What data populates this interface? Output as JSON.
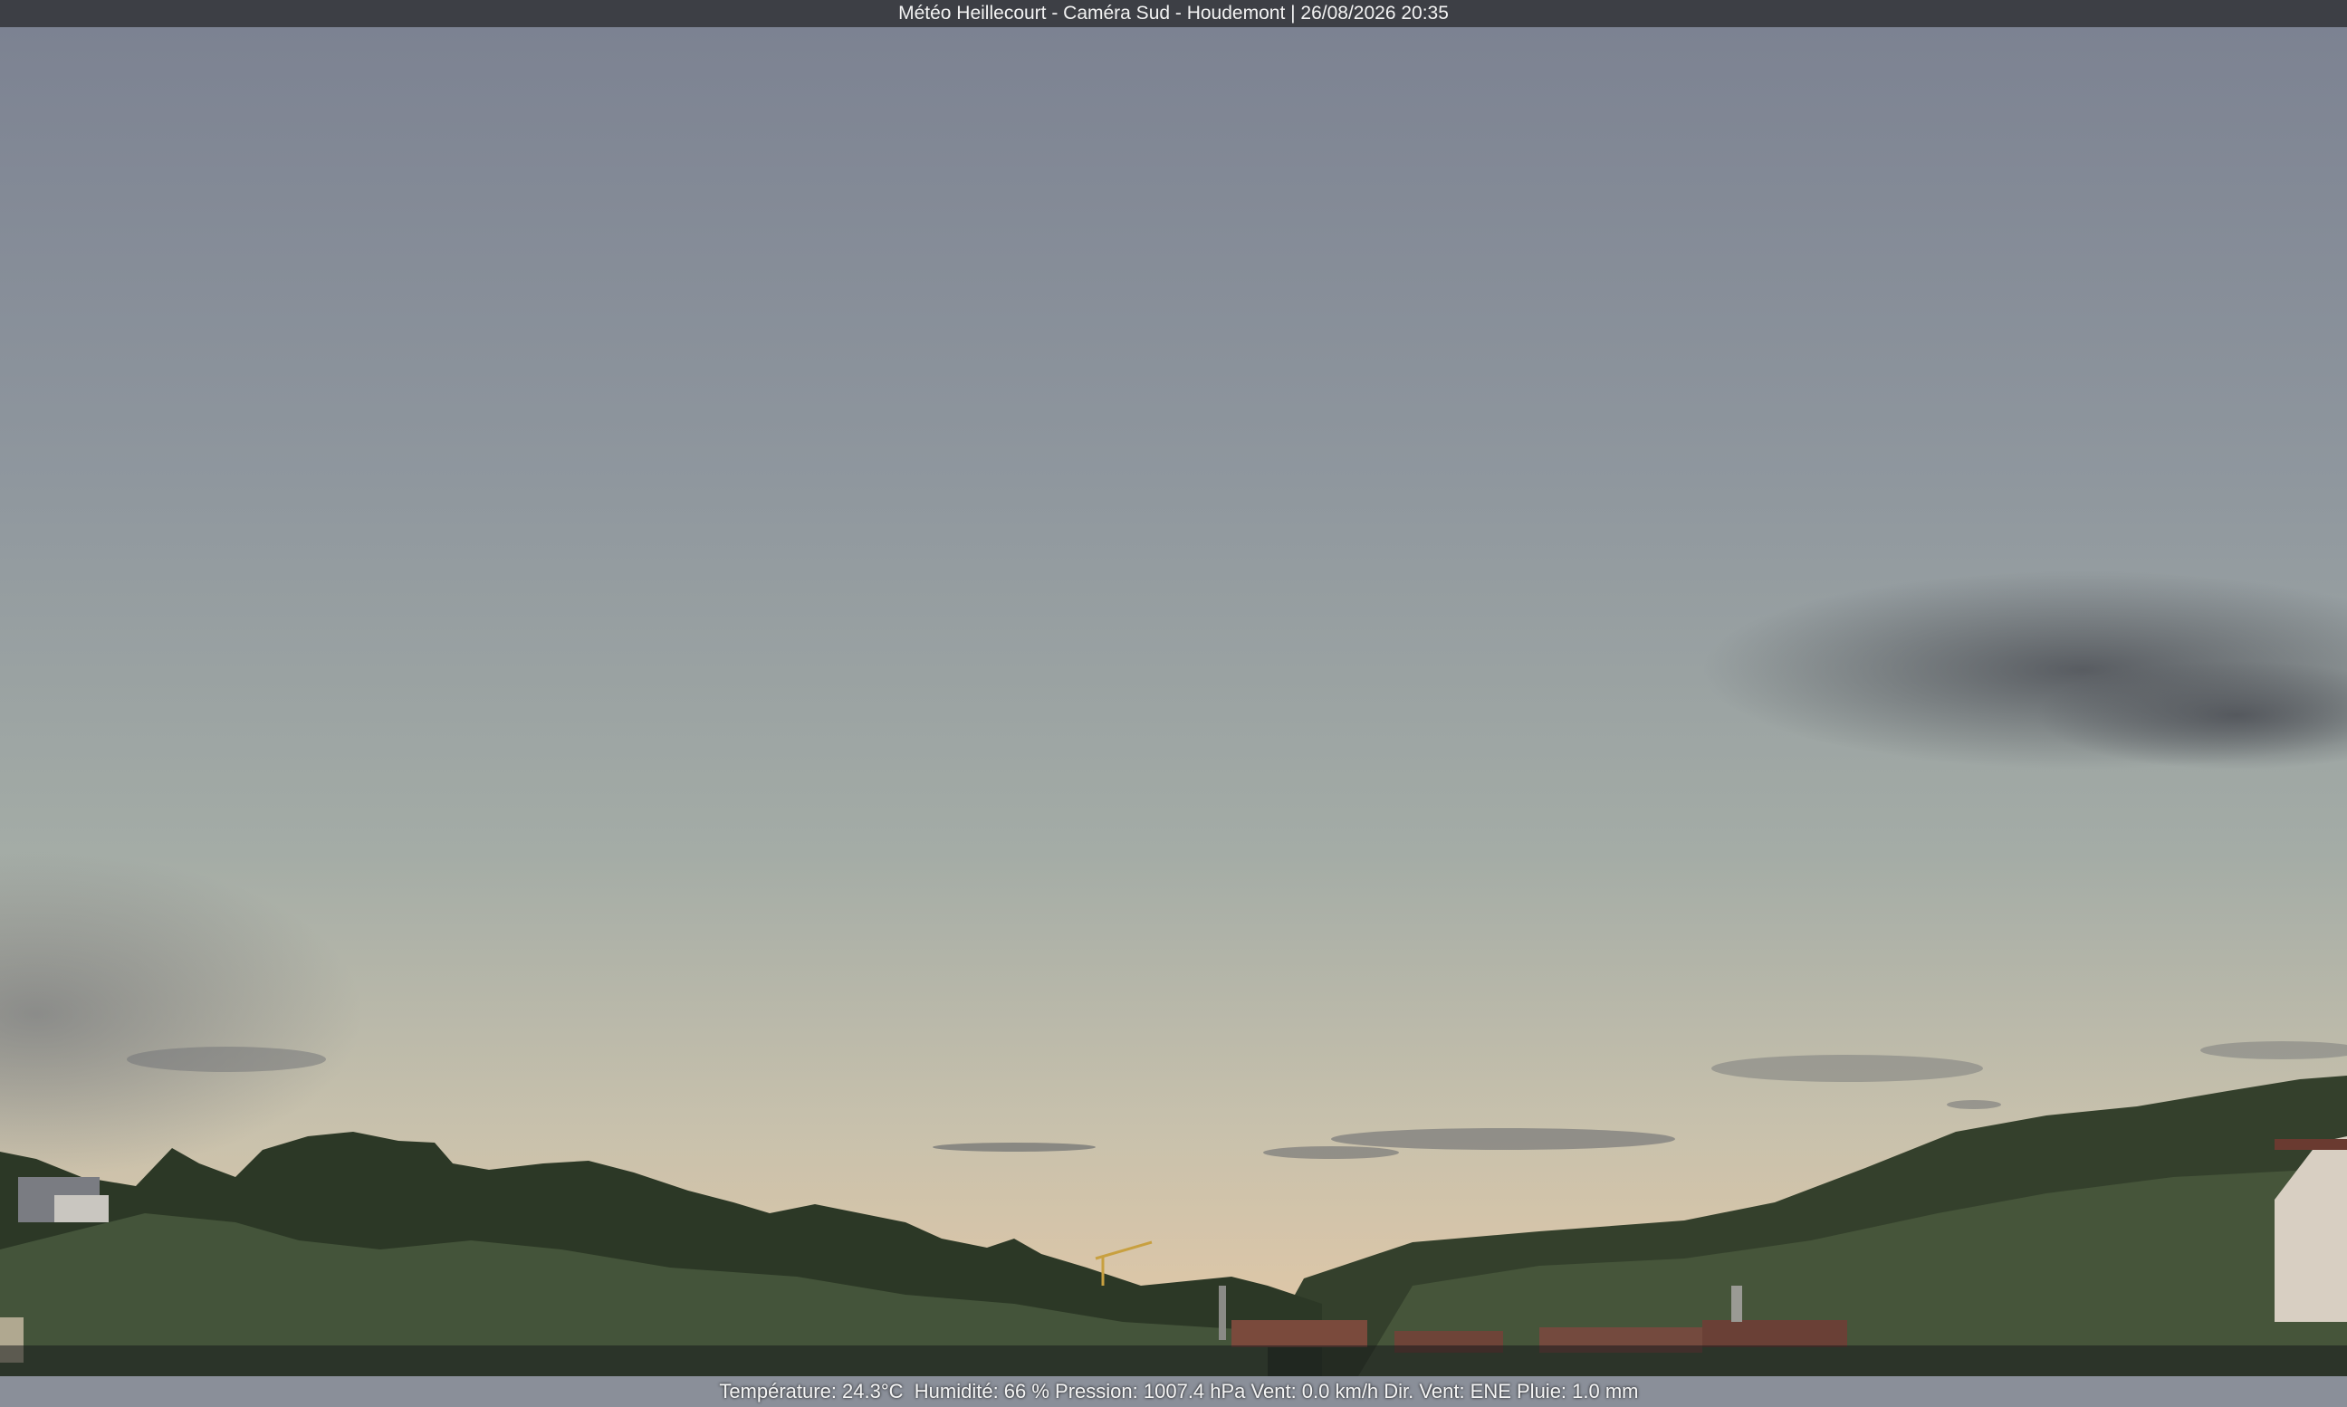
{
  "header": {
    "title": "Météo Heillecourt - Caméra Sud - Houdemont | 26/08/2026 20:35"
  },
  "weather": {
    "summary": "Température: 24.3°C  Humidité: 66 % Pression: 1007.4 hPa Vent: 0.0 km/h Dir. Vent: ENE Pluie: 1.0 mm"
  },
  "colors": {
    "sky_top": "#7c8292",
    "sky_mid": "#98a0a4",
    "sky_horizon": "#dcc8aa",
    "foliage_dark": "#2a3524",
    "foliage_light": "#4a5a3c",
    "title_bar": "#3a3c42"
  }
}
